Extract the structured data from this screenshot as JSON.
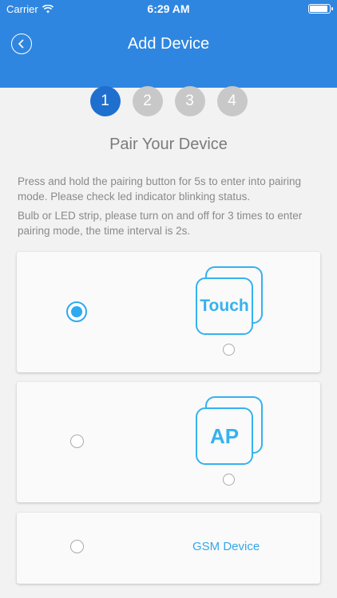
{
  "status_bar": {
    "carrier": "Carrier",
    "time": "6:29 AM"
  },
  "nav": {
    "title": "Add Device"
  },
  "steps": [
    {
      "label": "1",
      "active": true
    },
    {
      "label": "2",
      "active": false
    },
    {
      "label": "3",
      "active": false
    },
    {
      "label": "4",
      "active": false
    }
  ],
  "heading": "Pair Your Device",
  "description": {
    "line1": "Press and hold the pairing button for 5s to enter into pairing mode. Please check led indicator blinking status.",
    "line2": "Bulb or LED strip, please turn on and off for 3 times to enter pairing mode, the time interval is 2s."
  },
  "options": [
    {
      "label": "Touch",
      "selected": true
    },
    {
      "label": "AP",
      "selected": false
    },
    {
      "label": "GSM Device",
      "selected": false
    }
  ],
  "colors": {
    "nav": "#2f86e0",
    "accent": "#34b2f0",
    "step_active": "#1f6fcf"
  }
}
